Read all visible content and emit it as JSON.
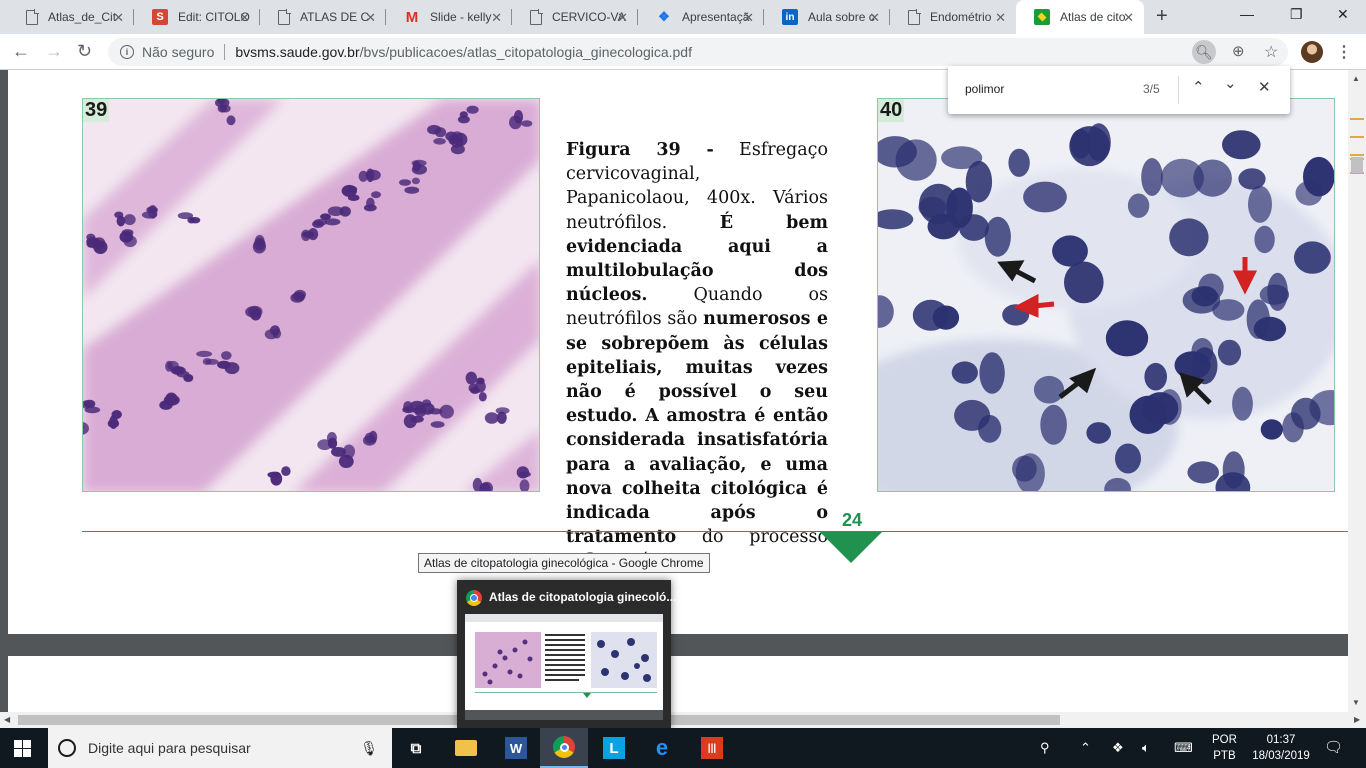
{
  "tabs": [
    {
      "title": "Atlas_de_Cit",
      "favicon": "doc-icon",
      "active": false
    },
    {
      "title": "Edit: CITOLO",
      "favicon": "s-icon",
      "active": false
    },
    {
      "title": "ATLAS DE C",
      "favicon": "doc-icon",
      "active": false
    },
    {
      "title": "Slide - kelly",
      "favicon": "gmail-icon",
      "active": false
    },
    {
      "title": "CERVICO-VA",
      "favicon": "doc-icon",
      "active": false
    },
    {
      "title": "Apresentaçã",
      "favicon": "leaf-icon",
      "active": false
    },
    {
      "title": "Aula sobre c",
      "favicon": "linkedin-icon",
      "active": false
    },
    {
      "title": "Endométrio",
      "favicon": "doc-icon",
      "active": false
    },
    {
      "title": "Atlas de cito",
      "favicon": "brazil-flag-icon",
      "active": true
    }
  ],
  "toolbar": {
    "security_label": "Não seguro",
    "url_host": "bvsms.saude.gov.br",
    "url_path": "/bvs/publicacoes/atlas_citopatologia_ginecologica.pdf"
  },
  "find": {
    "query": "polimor",
    "count": "3/5"
  },
  "page": {
    "fig39_label": "39",
    "fig40_label": "40",
    "caption_bold": "Figura 39 -",
    "caption_1": " Esfregaço cervicovaginal, Papanicolaou, 400x. Vários neutrófilos. ",
    "caption_bold2": "É bem evidenciada aqui a multilobulação dos núcleos.",
    "caption_2": " Quando os neutrófilos são ",
    "caption_bold3": "numerosos e se sobrepõem às células epiteliais, muitas vezes não é possível o seu estudo. A amostra é então considerada insatisfatória para a avaliação, e uma nova colheita citológica é indicada após o tratamento",
    "caption_3": " do processo inflamatório.",
    "page_number": "24"
  },
  "taskbar_preview": {
    "tooltip": "Atlas de citopatologia ginecológica - Google Chrome",
    "title": "Atlas de citopatologia ginecoló..."
  },
  "taskbar": {
    "search_placeholder": "Digite aqui para pesquisar",
    "lang_1": "POR",
    "lang_2": "PTB",
    "time": "01:37",
    "date": "18/03/2019"
  },
  "colors": {
    "accent_green": "#219150",
    "highlight": "#e6a54a"
  }
}
